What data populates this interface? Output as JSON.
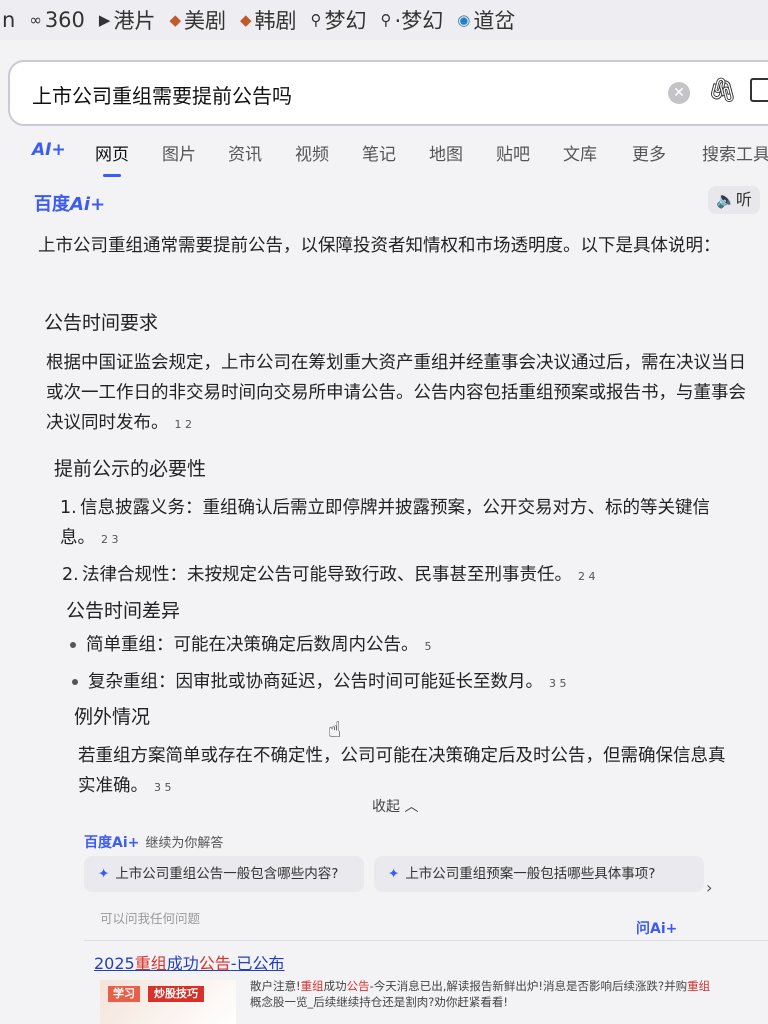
{
  "bookmarks": [
    {
      "icon": "letter-n",
      "label": "n"
    },
    {
      "icon": "infinity-icon",
      "label": "360"
    },
    {
      "icon": "play-circle-icon",
      "label": "港片"
    },
    {
      "icon": "diamond-icon",
      "label": "美剧"
    },
    {
      "icon": "diamond-icon",
      "label": "韩剧"
    },
    {
      "icon": "search-icon",
      "label": "梦幻"
    },
    {
      "icon": "search-icon",
      "label": "·梦幻"
    },
    {
      "icon": "circle-logo-icon",
      "label": "道岔"
    }
  ],
  "search": {
    "query": "上市公司重组需要提前公告吗"
  },
  "tabs": [
    "AI+",
    "网页",
    "图片",
    "资讯",
    "视频",
    "笔记",
    "地图",
    "贴吧",
    "文库",
    "更多",
    "搜索工具"
  ],
  "active_tab": "网页",
  "ai": {
    "brand_text": "百度",
    "brand_ai": "Ai+",
    "listen_label": "听",
    "intro": "上市公司重组通常需要提前公告，以保障投资者知情权和市场透明度。以下是具体说明：",
    "sec1_title": "公告时间要求",
    "sec1_body": "根据中国证监会规定，上市公司在筹划重大资产重组并经董事会决议通过后，需在决议当日或次一工作日的非交易时间向交易所申请公告。公告内容包括重组预案或报告书，与董事会决议同时发布。",
    "sec1_refs": "1  2",
    "sec2_title": "提前公示的必要性",
    "sec2_items": [
      {
        "num": "1.",
        "title": "信息披露义务：",
        "text": "重组确认后需立即停牌并披露预案，公开交易对方、标的等关键信息。",
        "refs": "2  3"
      },
      {
        "num": "2.",
        "title": "法律合规性：",
        "text": "未按规定公告可能导致行政、民事甚至刑事责任。",
        "refs": "2  4"
      }
    ],
    "sec3_title": "公告时间差异",
    "sec3_items": [
      {
        "title": "简单重组：",
        "text": "可能在决策确定后数周内公告。",
        "refs": "5"
      },
      {
        "title": "复杂重组：",
        "text": "因审批或协商延迟，公告时间可能延长至数月。",
        "refs": "3  5"
      }
    ],
    "sec4_title": "例外情况",
    "sec4_body": "若重组方案简单或存在不确定性，公司可能在决策确定后及时公告，但需确保信息真实准确。",
    "sec4_refs": "3  5",
    "collapse_label": "收起 ︿"
  },
  "continue": {
    "brand": "百度Ai+",
    "label": "继续为你解答",
    "chips": [
      "上市公司重组公告一般包含哪些内容?",
      "上市公司重组预案一般包括哪些具体事项?"
    ],
    "ask_hint": "可以问我任何问题",
    "ask_ai": "问Ai+"
  },
  "result": {
    "title_parts": [
      "2025",
      "重组",
      "成功",
      "公告",
      "-已公布"
    ],
    "thumb_badge1": "学习",
    "thumb_badge2": "炒股技巧",
    "desc_parts": [
      "散户注意!",
      "重组",
      "成功",
      "公告",
      "-今天消息已出,解读报告新鲜出炉!消息是否影响后续涨跌?并购",
      "重组",
      "概念股一览_后续继续持仓还是割肉?劝你赶紧看看!"
    ]
  }
}
